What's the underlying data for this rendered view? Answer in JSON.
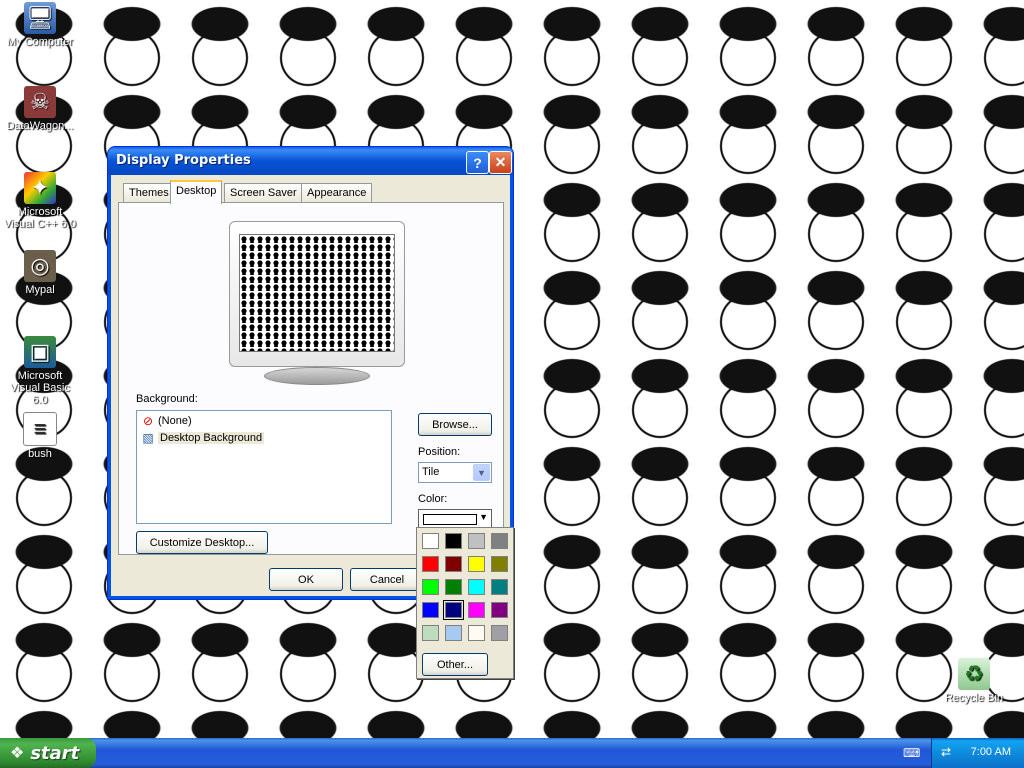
{
  "desktop": {
    "icons": [
      {
        "label": "My Computer",
        "icon": "my-computer-icon"
      },
      {
        "label": "DataWagon...",
        "icon": "app-shortcut-icon"
      },
      {
        "label": "Microsoft Visual C++ 6.0",
        "icon": "visual-cpp-icon"
      },
      {
        "label": "Mypal",
        "icon": "mypal-icon"
      },
      {
        "label": "Microsoft Visual Basic 6.0",
        "icon": "visual-basic-icon"
      },
      {
        "label": "bush",
        "icon": "text-file-icon"
      },
      {
        "label": "Recycle Bin",
        "icon": "recycle-bin-icon"
      }
    ]
  },
  "dialog": {
    "title": "Display Properties",
    "help": "?",
    "close": "✕",
    "tabs": [
      "Themes",
      "Desktop",
      "Screen Saver",
      "Appearance"
    ],
    "active_tab": "Desktop",
    "background_label": "Background:",
    "background_items": [
      {
        "label": "(None)",
        "icon": "none-icon"
      },
      {
        "label": "Desktop Background",
        "icon": "image-file-icon",
        "selected": true
      }
    ],
    "browse": "Browse...",
    "position_label": "Position:",
    "position_value": "Tile",
    "color_label": "Color:",
    "color_value": "#ffffff",
    "customize": "Customize Desktop...",
    "ok": "OK",
    "cancel": "Cancel"
  },
  "palette": {
    "colors": [
      "#ffffff",
      "#000000",
      "#c0c0c0",
      "#808080",
      "#ff0000",
      "#800000",
      "#ffff00",
      "#808000",
      "#00ff00",
      "#008000",
      "#00ffff",
      "#008080",
      "#0000ff",
      "#000080",
      "#ff00ff",
      "#800080",
      "#c0dcc0",
      "#a6caf0",
      "#fffbf0",
      "#a0a0a4"
    ],
    "selected_index": 13,
    "other": "Other..."
  },
  "taskbar": {
    "start": "start",
    "clock": "7:00 AM"
  }
}
